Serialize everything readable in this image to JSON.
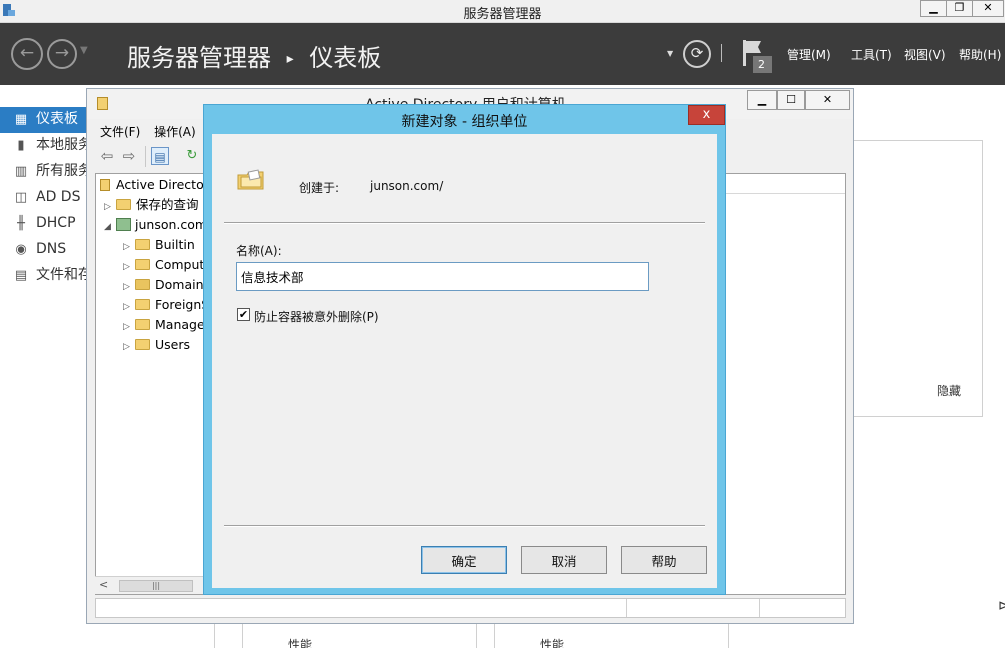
{
  "server_manager": {
    "title": "服务器管理器",
    "breadcrumb_root": "服务器管理器",
    "breadcrumb_sep": "▸",
    "breadcrumb_page": "仪表板",
    "flag_count": "2",
    "menus": [
      "管理(M)",
      "工具(T)",
      "视图(V)",
      "帮助(H)"
    ],
    "sidebar": [
      {
        "label": "仪表板",
        "icon": "grid-icon"
      },
      {
        "label": "本地服务",
        "icon": "server-icon"
      },
      {
        "label": "所有服务",
        "icon": "servers-icon"
      },
      {
        "label": "AD DS",
        "icon": "ad-ds-icon"
      },
      {
        "label": "DHCP",
        "icon": "dhcp-icon"
      },
      {
        "label": "DNS",
        "icon": "dns-icon"
      },
      {
        "label": "文件和存",
        "icon": "file-storage-icon"
      }
    ],
    "hide_label": "隐藏",
    "perf_label_1": "性能",
    "perf_label_2": "性能"
  },
  "aduc": {
    "title": "Active Directory 用户和计算机",
    "menus": [
      "文件(F)",
      "操作(A)"
    ],
    "tree": {
      "root": "Active Directory",
      "saved_queries": "保存的查询",
      "domain": "junson.com",
      "children": [
        "Builtin",
        "Computers",
        "Domain Controllers",
        "ForeignSecurityPrincipals",
        "Managed Service Accounts",
        "Users"
      ]
    }
  },
  "dialog": {
    "title": "新建对象 - 组织单位",
    "close_symbol": "x",
    "created_in_label": "创建于:",
    "created_in_value": "junson.com/",
    "name_label": "名称(A):",
    "name_value": "信息技术部",
    "protect_label": "防止容器被意外删除(P)",
    "protect_checked": true,
    "ok_label": "确定",
    "cancel_label": "取消",
    "help_label": "帮助"
  }
}
